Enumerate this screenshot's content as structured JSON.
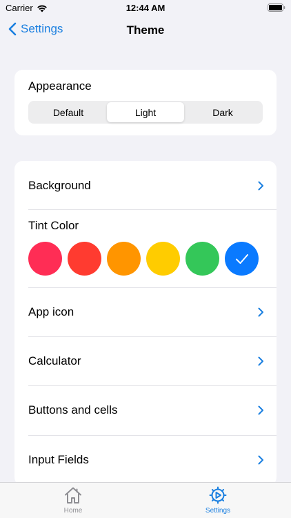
{
  "status_bar": {
    "carrier": "Carrier",
    "time": "12:44 AM"
  },
  "nav": {
    "back_label": "Settings",
    "title": "Theme"
  },
  "appearance": {
    "label": "Appearance",
    "options": [
      "Default",
      "Light",
      "Dark"
    ],
    "selected": "Light"
  },
  "list": {
    "background": "Background",
    "tint_color": "Tint Color",
    "app_icon": "App icon",
    "calculator": "Calculator",
    "buttons_cells": "Buttons and cells",
    "input_fields": "Input Fields"
  },
  "tint_swatches": [
    {
      "name": "pink",
      "color": "#ff2d55",
      "selected": false
    },
    {
      "name": "red",
      "color": "#ff3b30",
      "selected": false
    },
    {
      "name": "orange",
      "color": "#ff9500",
      "selected": false
    },
    {
      "name": "yellow",
      "color": "#ffcc00",
      "selected": false
    },
    {
      "name": "green",
      "color": "#34c759",
      "selected": false
    },
    {
      "name": "blue",
      "color": "#0a7aff",
      "selected": true
    }
  ],
  "tabs": {
    "home_label": "Home",
    "settings_label": "Settings"
  },
  "colors": {
    "accent": "#1a7fe0",
    "tab_inactive": "#8e8e93"
  }
}
